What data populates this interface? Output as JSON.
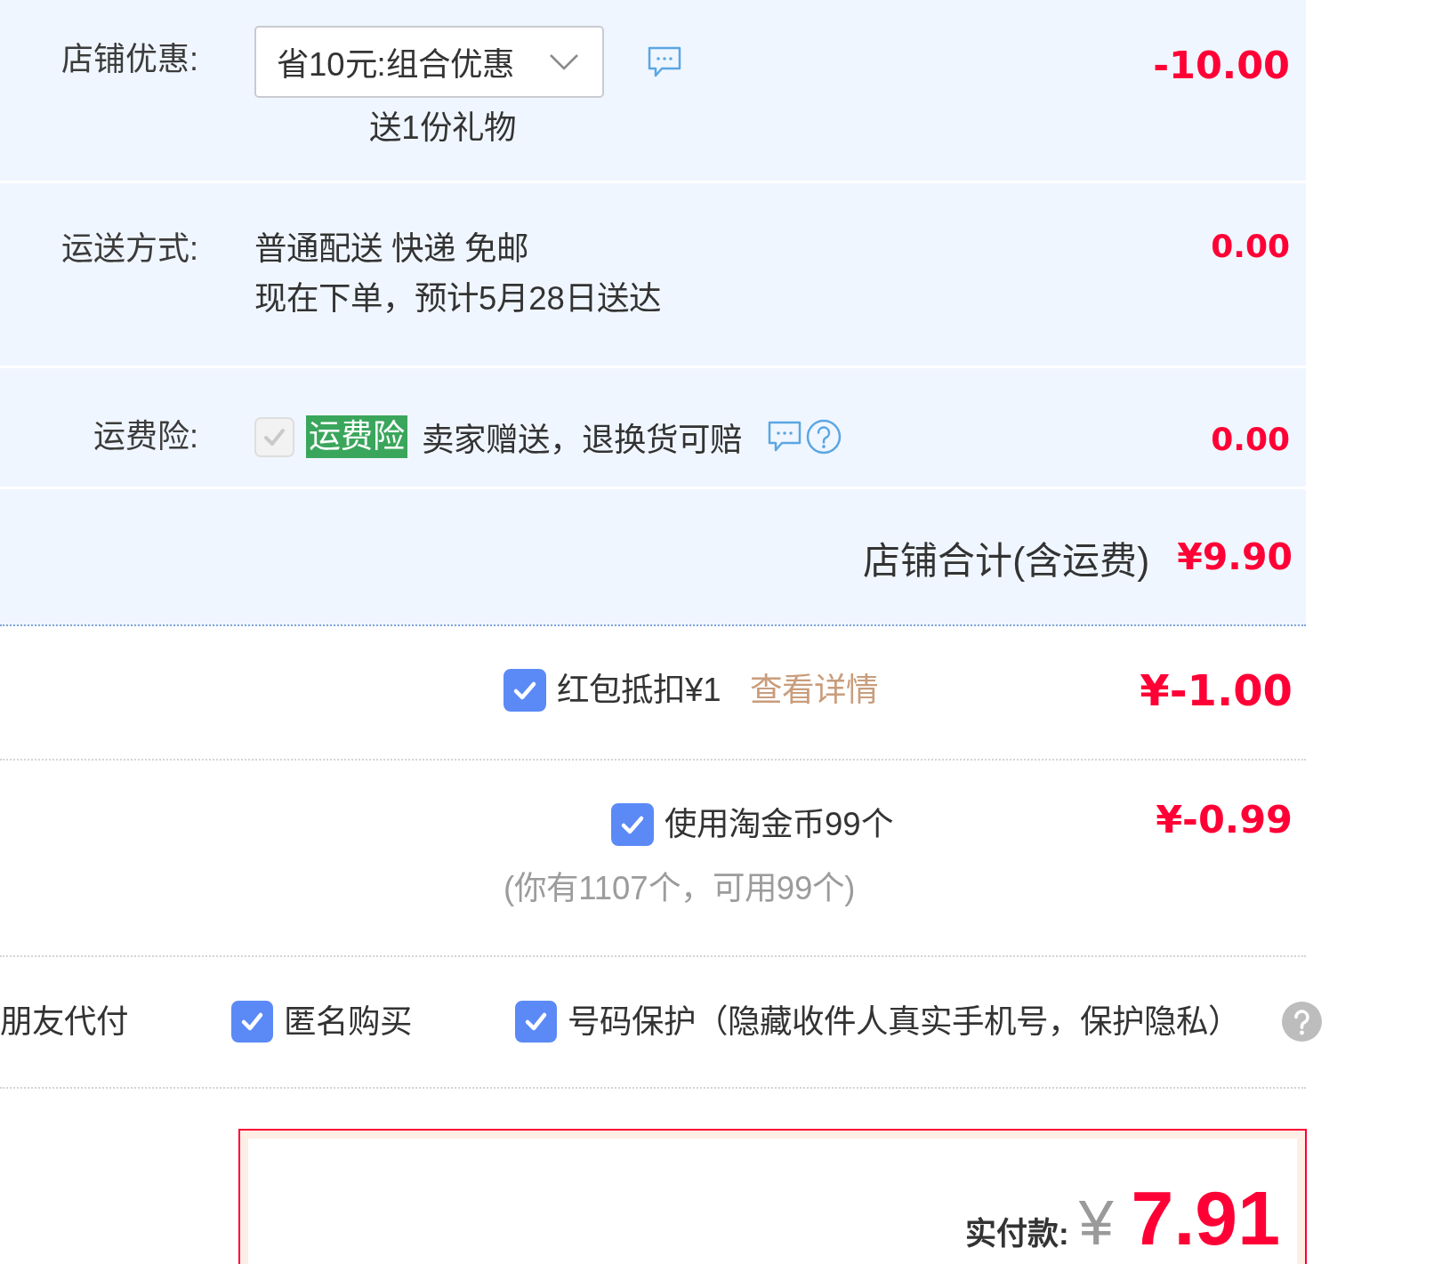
{
  "shop": {
    "discount": {
      "label": "店铺优惠:",
      "selected_offer": "省10元:组合优惠",
      "gift": "送1份礼物",
      "amount": "-10.00"
    },
    "shipping": {
      "label": "运送方式:",
      "method": "普通配送 快递 免邮",
      "estimate": "现在下单，预计5月28日送达",
      "amount": "0.00"
    },
    "insurance": {
      "label": "运费险:",
      "checked": true,
      "disabled": true,
      "tag": "运费险",
      "text": "卖家赠送，退换货可赔",
      "amount": "0.00"
    },
    "total": {
      "label": "店铺合计(含运费)",
      "amount": "¥9.90"
    }
  },
  "deductions": [
    {
      "kind": "voucher",
      "checked": true,
      "label": "红包抵扣¥1",
      "link": "查看详情",
      "amount": "¥-1.00"
    },
    {
      "kind": "coins",
      "checked": true,
      "label": "使用淘金币99个",
      "note": "(你有1107个，可用99个)",
      "amount": "¥-0.99"
    }
  ],
  "options": [
    {
      "kind": "plain",
      "label": "朋友代付"
    },
    {
      "kind": "checkbox",
      "checked": true,
      "label": "匿名购买"
    },
    {
      "kind": "checkbox",
      "checked": true,
      "label": "号码保护（隐藏收件人真实手机号，保护隐私）",
      "help": true
    }
  ],
  "payment": {
    "label": "实付款:",
    "currency": "¥",
    "amount": "7.91"
  }
}
